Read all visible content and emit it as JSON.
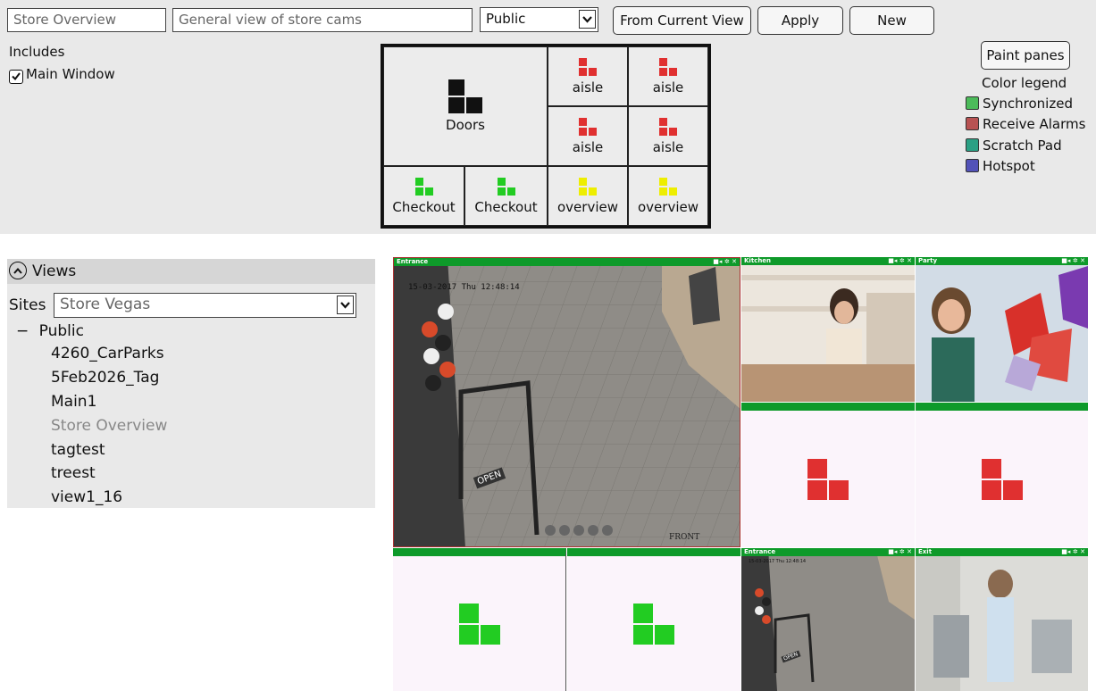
{
  "editor": {
    "view_name": "Store Overview",
    "description": "General view of store cams",
    "visibility": "Public",
    "from_current_view": "From Current View",
    "apply": "Apply",
    "new": "New",
    "includes_label": "Includes",
    "main_window_label": "Main Window",
    "main_window_checked": true
  },
  "layout_panes": [
    {
      "label": "Doors",
      "color": "#111111"
    },
    {
      "label": "aisle",
      "color": "#e03030"
    },
    {
      "label": "aisle",
      "color": "#e03030"
    },
    {
      "label": "aisle",
      "color": "#e03030"
    },
    {
      "label": "aisle",
      "color": "#e03030"
    },
    {
      "label": "Checkout",
      "color": "#22cc22"
    },
    {
      "label": "Checkout",
      "color": "#22cc22"
    },
    {
      "label": "overview",
      "color": "#eeee00"
    },
    {
      "label": "overview",
      "color": "#eeee00"
    }
  ],
  "legend": {
    "paint_panes": "Paint panes",
    "title": "Color legend",
    "items": [
      {
        "label": "Synchronized",
        "color": "#4cbb5a"
      },
      {
        "label": "Receive Alarms",
        "color": "#b85252"
      },
      {
        "label": "Scratch Pad",
        "color": "#2aa084"
      },
      {
        "label": "Hotspot",
        "color": "#5252b8"
      }
    ]
  },
  "views": {
    "title": "Views",
    "sites_label": "Sites",
    "site_value": "Store Vegas",
    "group": "Public",
    "items": [
      "4260_CarParks",
      "5Feb2026_Tag",
      "Main1",
      "Store Overview",
      "tagtest",
      "treest",
      "view1_16"
    ],
    "selected": "Store Overview"
  },
  "cameras": {
    "entrance_main": {
      "title": "Entrance",
      "timestamp": "15-03-2017 Thu 12:48:14",
      "sign": "OPEN",
      "watermark": "FRONT"
    },
    "kitchen": {
      "title": "Kitchen"
    },
    "party": {
      "title": "Party"
    },
    "entrance_small": {
      "title": "Entrance",
      "timestamp": "15-03-2017 Thu 12:48:14",
      "sign": "OPEN"
    },
    "exit": {
      "title": "Exit"
    }
  },
  "colors": {
    "tile_bar": "#0e9a2a",
    "alarm_pane": "#e03030",
    "sync_pane": "#22cc22",
    "empty_bg": "#fbf4fb"
  }
}
